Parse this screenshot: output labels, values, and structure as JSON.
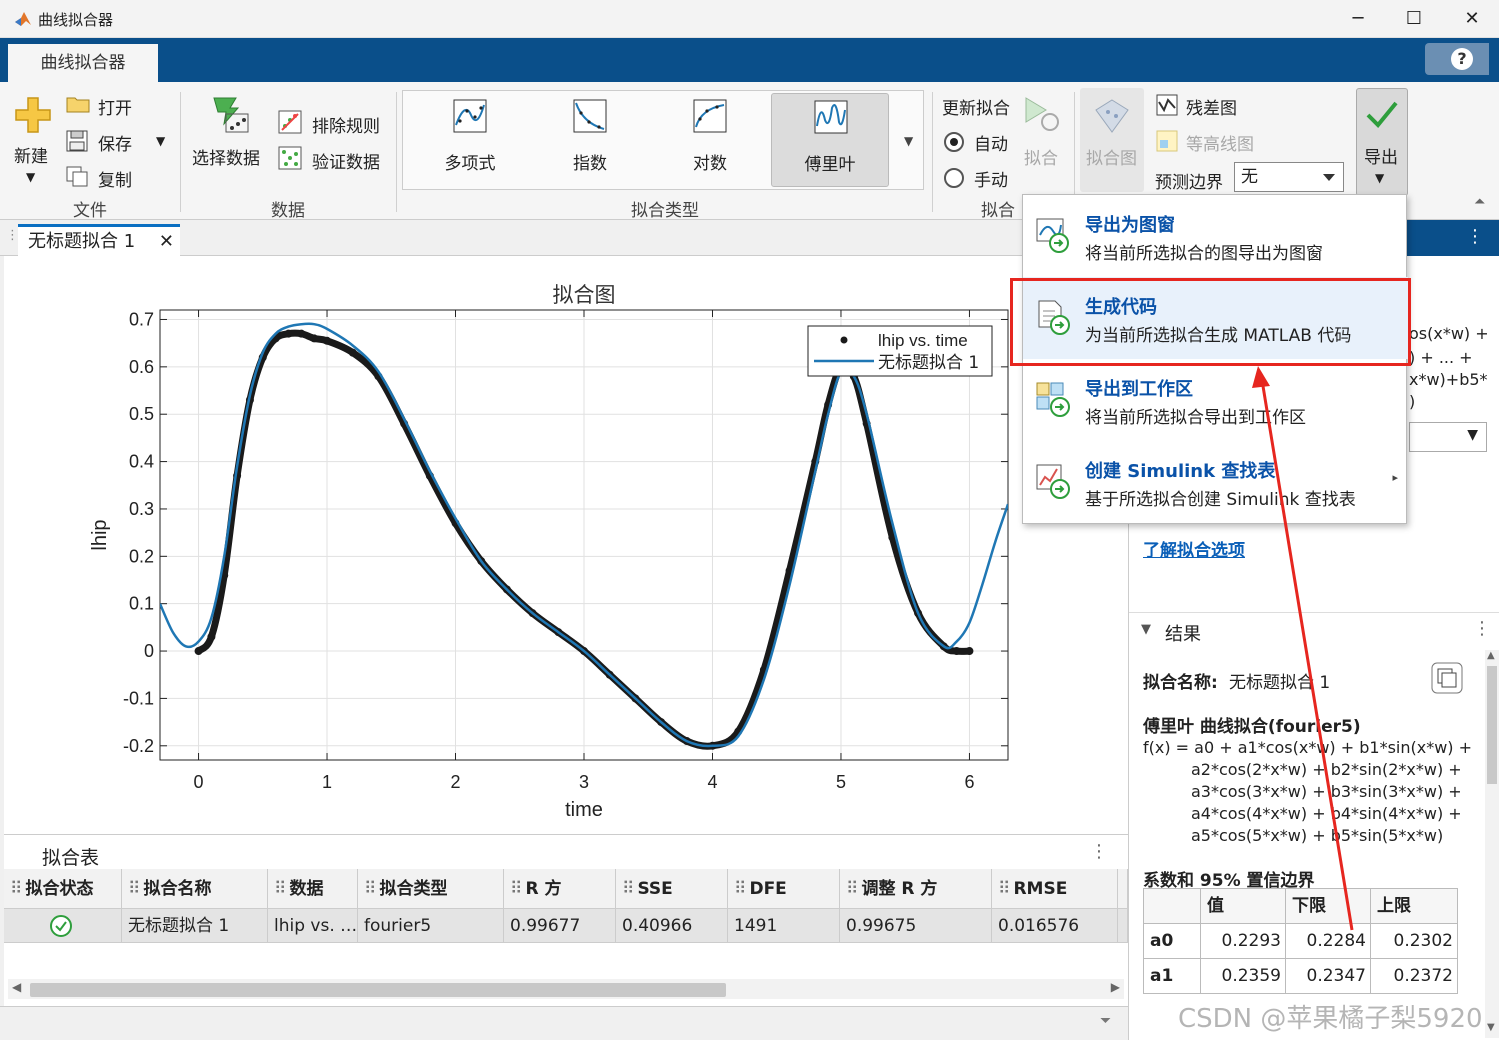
{
  "window": {
    "title": "曲线拟合器",
    "controls": [
      "─",
      "☐",
      "✕"
    ]
  },
  "ribbon": {
    "tab": "曲线拟合器",
    "help": "?",
    "file": {
      "new": "新建",
      "open": "打开",
      "save": "保存",
      "copy": "复制",
      "group": "文件"
    },
    "data": {
      "select": "选择数据",
      "exclude": "排除规则",
      "validate": "验证数据",
      "group": "数据"
    },
    "fit_types": {
      "items": [
        "多项式",
        "指数",
        "对数",
        "傅里叶"
      ],
      "selected": "傅里叶",
      "group": "拟合类型"
    },
    "fit": {
      "update": "更新拟合",
      "auto": "自动",
      "manual": "手动",
      "fit_button": "拟合",
      "group": "拟合"
    },
    "plots": {
      "fit_plot": "拟合图",
      "residual": "残差图",
      "contour": "等高线图",
      "bounds_label": "预测边界",
      "bounds_value": "无"
    },
    "export": "导出"
  },
  "doc_tab": {
    "label": "无标题拟合 1",
    "close": "✕"
  },
  "export_menu": [
    {
      "title": "导出为图窗",
      "desc": "将当前所选拟合的图导出为图窗"
    },
    {
      "title": "生成代码",
      "desc": "为当前所选拟合生成 MATLAB 代码"
    },
    {
      "title": "导出到工作区",
      "desc": "将当前所选拟合导出到工作区"
    },
    {
      "title": "创建 Simulink 查找表",
      "desc": "基于所选拟合创建 Simulink 查找表"
    }
  ],
  "fit_table": {
    "title": "拟合表",
    "columns": [
      "拟合状态",
      "拟合名称",
      "数据",
      "拟合类型",
      "R 方",
      "SSE",
      "DFE",
      "调整 R 方",
      "RMSE"
    ],
    "rows": [
      [
        "",
        "无标题拟合 1",
        "lhip vs. …",
        "fourier5",
        "0.99677",
        "0.40966",
        "1491",
        "0.99675",
        "0.016576"
      ]
    ]
  },
  "right_panel": {
    "partial_lines": [
      "os(x*w) +",
      ") + ... +",
      "x*w)+b5*",
      ")"
    ],
    "learn_link": "了解拟合选项",
    "results_header": "结果",
    "fit_name_label": "拟合名称:",
    "fit_name_value": "无标题拟合 1",
    "model_title": "傅里叶 曲线拟合(fourier5)",
    "equation": [
      "f(x) = a0 + a1*cos(x*w) + b1*sin(x*w) +",
      "a2*cos(2*x*w) + b2*sin(2*x*w) +",
      "a3*cos(3*x*w) + b3*sin(3*x*w) +",
      "a4*cos(4*x*w) + b4*sin(4*x*w) +",
      "a5*cos(5*x*w) + b5*sin(5*x*w)"
    ],
    "coef_title": "系数和 95% 置信边界",
    "coef_headers": [
      "",
      "值",
      "下限",
      "上限"
    ],
    "coef_rows": [
      [
        "a0",
        "0.2293",
        "0.2284",
        "0.2302"
      ],
      [
        "a1",
        "0.2359",
        "0.2347",
        "0.2372"
      ]
    ]
  },
  "watermark": "CSDN @苹果橘子梨5920",
  "chart_data": {
    "type": "line",
    "title": "拟合图",
    "xlabel": "time",
    "ylabel": "lhip",
    "xlim": [
      -0.3,
      6.3
    ],
    "ylim": [
      -0.23,
      0.72
    ],
    "xticks": [
      0,
      1,
      2,
      3,
      4,
      5,
      6
    ],
    "yticks": [
      -0.2,
      -0.1,
      0,
      0.1,
      0.2,
      0.3,
      0.4,
      0.5,
      0.6,
      0.7
    ],
    "ytick_labels": [
      "-0.2",
      "-0.1",
      "0",
      "0.1",
      "0.2",
      "0.3",
      "0.4",
      "0.5",
      "0.6",
      "0.7"
    ],
    "grid": true,
    "legend_position": "top-right",
    "series": [
      {
        "name": "lhip vs. time",
        "style": "markers",
        "color": "#1a1a1a",
        "x": [
          0.0,
          0.1,
          0.2,
          0.3,
          0.4,
          0.5,
          0.6,
          0.7,
          0.8,
          0.9,
          1.0,
          1.2,
          1.4,
          1.6,
          1.8,
          2.0,
          2.2,
          2.4,
          2.6,
          2.8,
          3.0,
          3.2,
          3.4,
          3.6,
          3.8,
          4.0,
          4.2,
          4.4,
          4.6,
          4.8,
          4.9,
          5.0,
          5.1,
          5.2,
          5.4,
          5.6,
          5.8,
          5.9,
          6.0
        ],
        "y": [
          0.0,
          0.03,
          0.16,
          0.37,
          0.53,
          0.62,
          0.66,
          0.67,
          0.67,
          0.66,
          0.655,
          0.63,
          0.58,
          0.48,
          0.37,
          0.27,
          0.19,
          0.13,
          0.08,
          0.04,
          0.0,
          -0.05,
          -0.1,
          -0.15,
          -0.19,
          -0.2,
          -0.17,
          -0.04,
          0.17,
          0.4,
          0.52,
          0.6,
          0.58,
          0.48,
          0.24,
          0.08,
          0.01,
          0.0,
          0.0
        ]
      },
      {
        "name": "无标题拟合 1",
        "style": "line",
        "color": "#1f77b4",
        "x": [
          -0.3,
          -0.2,
          -0.1,
          0.0,
          0.1,
          0.2,
          0.3,
          0.4,
          0.5,
          0.6,
          0.7,
          0.8,
          0.9,
          1.0,
          1.2,
          1.4,
          1.6,
          1.8,
          2.0,
          2.2,
          2.4,
          2.6,
          2.8,
          3.0,
          3.2,
          3.4,
          3.6,
          3.8,
          4.0,
          4.2,
          4.4,
          4.6,
          4.8,
          4.9,
          5.0,
          5.1,
          5.2,
          5.4,
          5.6,
          5.8,
          5.9,
          6.0,
          6.1,
          6.2,
          6.3
        ],
        "y": [
          0.1,
          0.04,
          0.01,
          0.02,
          0.07,
          0.2,
          0.39,
          0.54,
          0.63,
          0.67,
          0.685,
          0.69,
          0.69,
          0.68,
          0.645,
          0.59,
          0.49,
          0.38,
          0.28,
          0.19,
          0.13,
          0.08,
          0.04,
          0.0,
          -0.05,
          -0.1,
          -0.15,
          -0.19,
          -0.2,
          -0.18,
          -0.06,
          0.14,
          0.38,
          0.5,
          0.59,
          0.58,
          0.5,
          0.27,
          0.08,
          0.01,
          0.02,
          0.06,
          0.14,
          0.23,
          0.31
        ]
      }
    ]
  }
}
